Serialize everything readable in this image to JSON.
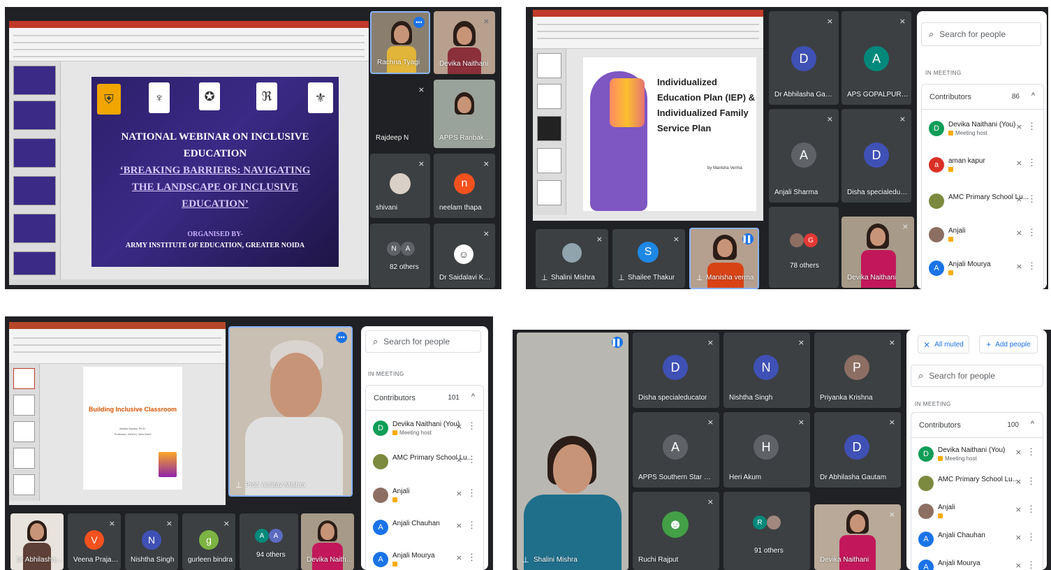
{
  "panel1": {
    "slide": {
      "lines": [
        "NATIONAL WEBINAR ON INCLUSIVE",
        "EDUCATION",
        "‘BREAKING BARRIERS: NAVIGATING",
        "THE LANDSCAPE OF INCLUSIVE",
        "EDUCATION’"
      ],
      "organised": "ORGANISED BY-",
      "org": "ARMY INSTITUTE OF EDUCATION, GREATER NOIDA"
    },
    "tiles": [
      {
        "name": "Rachna Tyagi"
      },
      {
        "name": "Devika Naithani"
      },
      {
        "name": "Rajdeep N"
      },
      {
        "name": "APPS Ranbakura B..."
      },
      {
        "name": "shivani"
      },
      {
        "name": "neelam thapa",
        "initial": "n"
      },
      {
        "name": "82 others",
        "initials": [
          "N",
          "A"
        ]
      },
      {
        "name": "Dr Saidalavi Kund..."
      }
    ]
  },
  "panel2": {
    "slide": {
      "title": [
        "Individualized",
        "Education Plan (IEP) &",
        "Individualized Family",
        "Service Plan"
      ],
      "byline": "by Manisha Verma"
    },
    "tiles": [
      {
        "name": "Dr Abhilasha Gauta...",
        "initial": "D"
      },
      {
        "name": "APS GOPALPUR, Pr...",
        "initial": "A"
      },
      {
        "name": "Anjali Sharma",
        "initial": "A"
      },
      {
        "name": "Disha specialeduca...",
        "initial": "D"
      },
      {
        "name": "78 others",
        "initial": "G"
      },
      {
        "name": "Devika Naithani"
      },
      {
        "name": "Shalini Mishra"
      },
      {
        "name": "Shailee Thakur",
        "initial": "S"
      },
      {
        "name": "Manisha verma"
      }
    ],
    "sidebar": {
      "search_placeholder": "Search for people",
      "in_meeting": "IN MEETING",
      "contributors": "Contributors",
      "count": "86",
      "people": [
        {
          "name": "Devika Naithani (You)",
          "sub": "Meeting host",
          "initial": "D",
          "color": "#0f9d58"
        },
        {
          "name": "aman kapur",
          "sub": "",
          "initial": "a",
          "color": "#d93025"
        },
        {
          "name": "AMC Primary School Lu...",
          "sub": "",
          "initial": "",
          "color": "#7b8a3e"
        },
        {
          "name": "Anjali",
          "sub": "",
          "initial": "",
          "color": "#8d6e63"
        },
        {
          "name": "Anjali Mourya",
          "sub": "",
          "initial": "A",
          "color": "#1a73e8"
        }
      ]
    }
  },
  "panel3": {
    "slide": {
      "title": "Building Inclusive Classroom",
      "author": "Amitav Mishra, Ph.D.",
      "affil": "Professor, IGNOU, New Delhi"
    },
    "speaker": "Prof. Amitav Mishra",
    "tiles": [
      {
        "name": "Dr Abhilasha Gau..."
      },
      {
        "name": "Veena Prajapat",
        "initial": "V"
      },
      {
        "name": "Nishtha Singh",
        "initial": "N"
      },
      {
        "name": "gurleen bindra",
        "initial": "g"
      },
      {
        "name": "94 others",
        "initials": [
          "A",
          "A"
        ]
      },
      {
        "name": "Devika Naithani"
      }
    ],
    "sidebar": {
      "search_placeholder": "Search for people",
      "in_meeting": "IN MEETING",
      "contributors": "Contributors",
      "count": "101",
      "people": [
        {
          "name": "Devika Naithani (You)",
          "sub": "Meeting host",
          "initial": "D",
          "color": "#0f9d58"
        },
        {
          "name": "AMC Primary School Lu...",
          "sub": "",
          "initial": "",
          "color": "#7b8a3e"
        },
        {
          "name": "Anjali",
          "sub": "",
          "initial": "",
          "color": "#8d6e63"
        },
        {
          "name": "Anjali Chauhan",
          "sub": "",
          "initial": "A",
          "color": "#1a73e8"
        },
        {
          "name": "Anjali Mourya",
          "sub": "",
          "initial": "A",
          "color": "#1a73e8"
        }
      ]
    }
  },
  "panel4": {
    "main_speaker": "Shalini Mishra",
    "tiles": [
      {
        "name": "Disha specialeducator",
        "initial": "D"
      },
      {
        "name": "Nishtha Singh",
        "initial": "N"
      },
      {
        "name": "Priyanka Krishna",
        "initial": "P"
      },
      {
        "name": "APPS Southern Star Pune",
        "initial": "A"
      },
      {
        "name": "Heri Akum",
        "initial": "H"
      },
      {
        "name": "Dr Abhilasha Gautam",
        "initial": "D"
      },
      {
        "name": "Ruchi Rajput"
      },
      {
        "name": "91 others",
        "initial": "R"
      },
      {
        "name": "Devika Naithani"
      }
    ],
    "sidebar": {
      "all_muted": "All muted",
      "add_people": "Add people",
      "search_placeholder": "Search for people",
      "in_meeting": "IN MEETING",
      "contributors": "Contributors",
      "count": "100",
      "people": [
        {
          "name": "Devika Naithani (You)",
          "sub": "Meeting host",
          "initial": "D",
          "color": "#0f9d58"
        },
        {
          "name": "AMC Primary School Lu...",
          "sub": "",
          "initial": "",
          "color": "#7b8a3e"
        },
        {
          "name": "Anjali",
          "sub": "",
          "initial": "",
          "color": "#8d6e63"
        },
        {
          "name": "Anjali Chauhan",
          "sub": "",
          "initial": "A",
          "color": "#1a73e8"
        },
        {
          "name": "Anjali Mourya",
          "sub": "",
          "initial": "A",
          "color": "#1a73e8"
        }
      ]
    }
  },
  "colors": {
    "meet_dark": "#202124",
    "tile": "#3c4043",
    "accent_blue": "#1a73e8",
    "ppt_red": "#c0392b"
  }
}
